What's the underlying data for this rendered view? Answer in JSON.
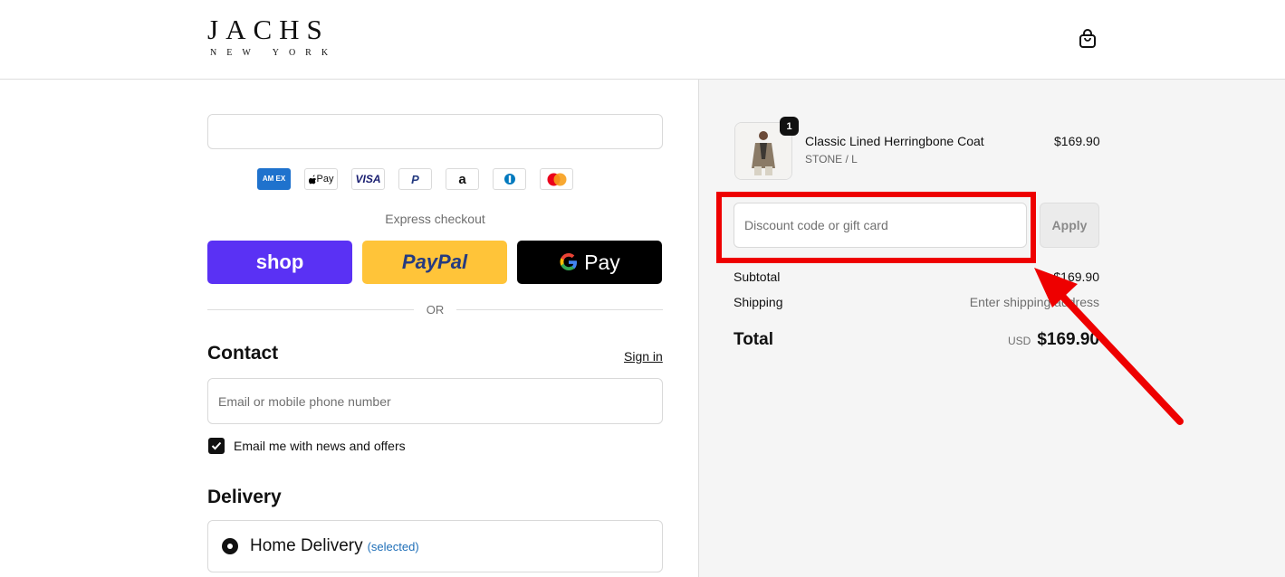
{
  "brand": {
    "name": "JACHS",
    "location": "NEW YORK"
  },
  "header": {
    "cart_icon": "shopping-bag-icon"
  },
  "express": {
    "payment_icons": [
      "AMEX",
      "Apple Pay",
      "VISA",
      "PayPal",
      "Amazon",
      "Diners",
      "Mastercard"
    ],
    "apple_label": "Pay",
    "visa_label": "VISA",
    "amex_label": "AM EX",
    "paypal_icon_label": "P",
    "amazon_label": "a",
    "diners_label": "D",
    "label": "Express checkout",
    "shop_label": "shop",
    "paypal_label": "PayPal",
    "gpay_label": "Pay",
    "or_label": "OR"
  },
  "contact": {
    "title": "Contact",
    "signin_label": "Sign in",
    "email_placeholder": "Email or mobile phone number",
    "news_label": "Email me with news and offers"
  },
  "delivery": {
    "title": "Delivery",
    "option_label": "Home Delivery",
    "option_state": "(selected)"
  },
  "cart": {
    "item": {
      "name": "Classic Lined Herringbone Coat",
      "variant": "STONE / L",
      "price": "$169.90",
      "quantity": "1"
    },
    "discount_placeholder": "Discount code or gift card",
    "apply_label": "Apply",
    "subtotal_label": "Subtotal",
    "subtotal_value": "$169.90",
    "shipping_label": "Shipping",
    "shipping_value": "Enter shipping address",
    "total_label": "Total",
    "total_currency": "USD",
    "total_value": "$169.90"
  },
  "colors": {
    "shop": "#5a31f4",
    "paypal": "#ffc439",
    "gpay": "#000000",
    "annotation": "#ee0000",
    "link_selected": "#1f6fb8"
  }
}
